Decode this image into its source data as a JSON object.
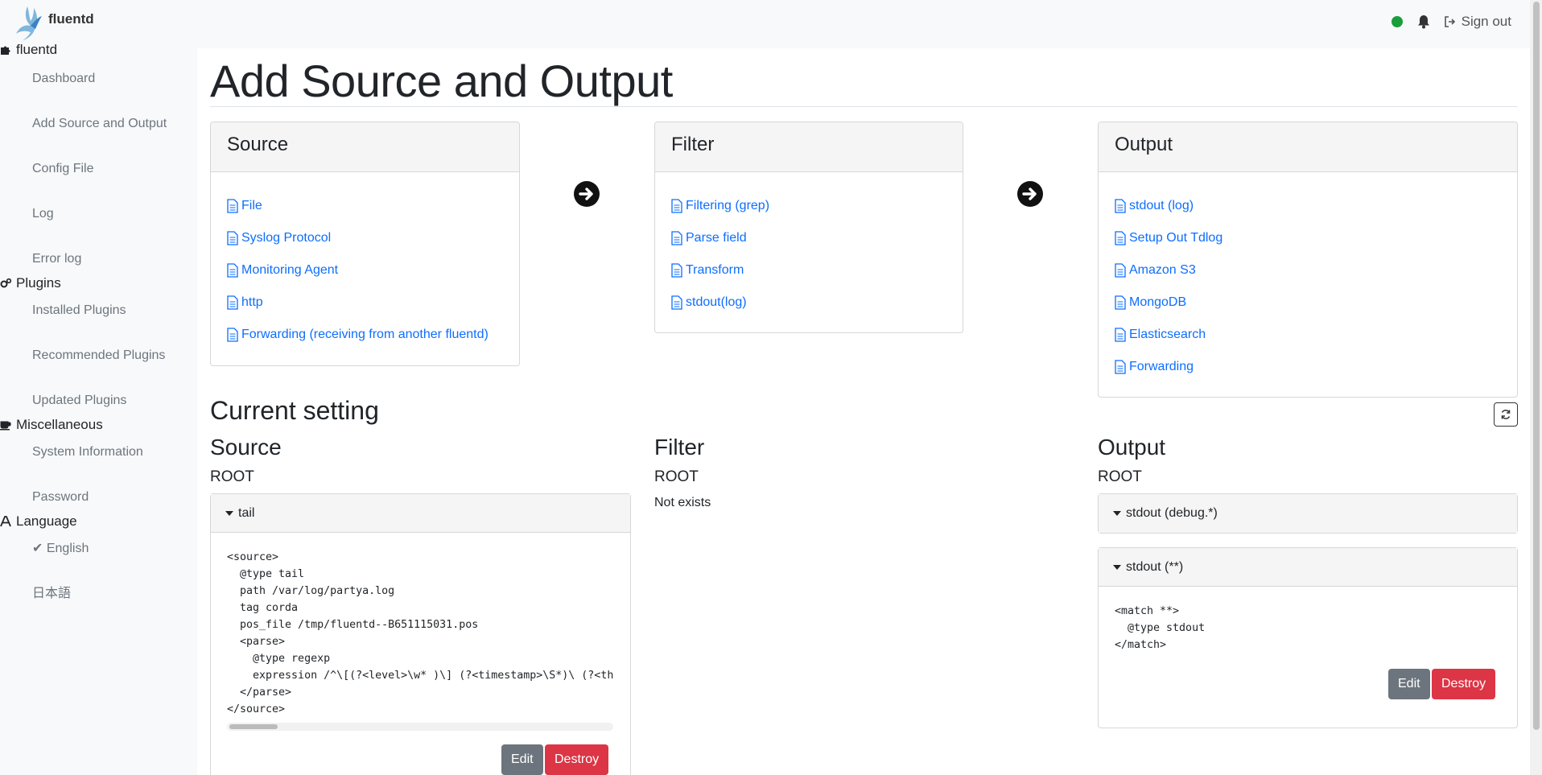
{
  "brand": {
    "name": "fluentd",
    "logo_icon": "fluentd-bird-logo-icon"
  },
  "topbar": {
    "status_color": "#1a9e3b",
    "sign_out": "Sign out"
  },
  "sidebar": {
    "sections": [
      {
        "title": "fluentd",
        "icon": "puzzle-icon",
        "items": [
          "Dashboard",
          "Add Source and Output",
          "Config File",
          "Log",
          "Error log"
        ]
      },
      {
        "title": "Plugins",
        "icon": "gears-icon",
        "items": [
          "Installed Plugins",
          "Recommended Plugins",
          "Updated Plugins"
        ]
      },
      {
        "title": "Miscellaneous",
        "icon": "coffee-icon",
        "items": [
          "System Information",
          "Password"
        ]
      },
      {
        "title": "Language",
        "icon": "font-icon",
        "items": [
          "English",
          "日本語"
        ]
      }
    ]
  },
  "page": {
    "title": "Add Source and Output"
  },
  "add": {
    "source": {
      "title": "Source",
      "items": [
        "File",
        "Syslog Protocol",
        "Monitoring Agent",
        "http",
        "Forwarding (receiving from another fluentd)"
      ]
    },
    "filter": {
      "title": "Filter",
      "items": [
        "Filtering (grep)",
        "Parse field",
        "Transform",
        "stdout(log)"
      ]
    },
    "output": {
      "title": "Output",
      "items": [
        "stdout (log)",
        "Setup Out Tdlog",
        "Amazon S3",
        "MongoDB",
        "Elasticsearch",
        "Forwarding"
      ]
    }
  },
  "current": {
    "title": "Current setting",
    "source": {
      "title": "Source",
      "root": "ROOT",
      "panel_title": "tail",
      "code": "<source>\n  @type tail\n  path /var/log/partya.log\n  tag corda\n  pos_file /tmp/fluentd--B651115031.pos\n  <parse>\n    @type regexp\n    expression /^\\[(?<level>\\w* )\\] (?<timestamp>\\S*)\\ (?<thread>\\S*)\\ (?<class>\\S*)\\ -\\ (?<message>.*)$/\n  </parse>\n</source>",
      "edit": "Edit",
      "destroy": "Destroy"
    },
    "filter": {
      "title": "Filter",
      "root": "ROOT",
      "empty": "Not exists"
    },
    "output": {
      "title": "Output",
      "root": "ROOT",
      "panel1_title": "stdout (debug.*)",
      "panel2_title": "stdout (**)",
      "code": "<match **>\n  @type stdout\n</match>",
      "edit": "Edit",
      "destroy": "Destroy"
    }
  }
}
